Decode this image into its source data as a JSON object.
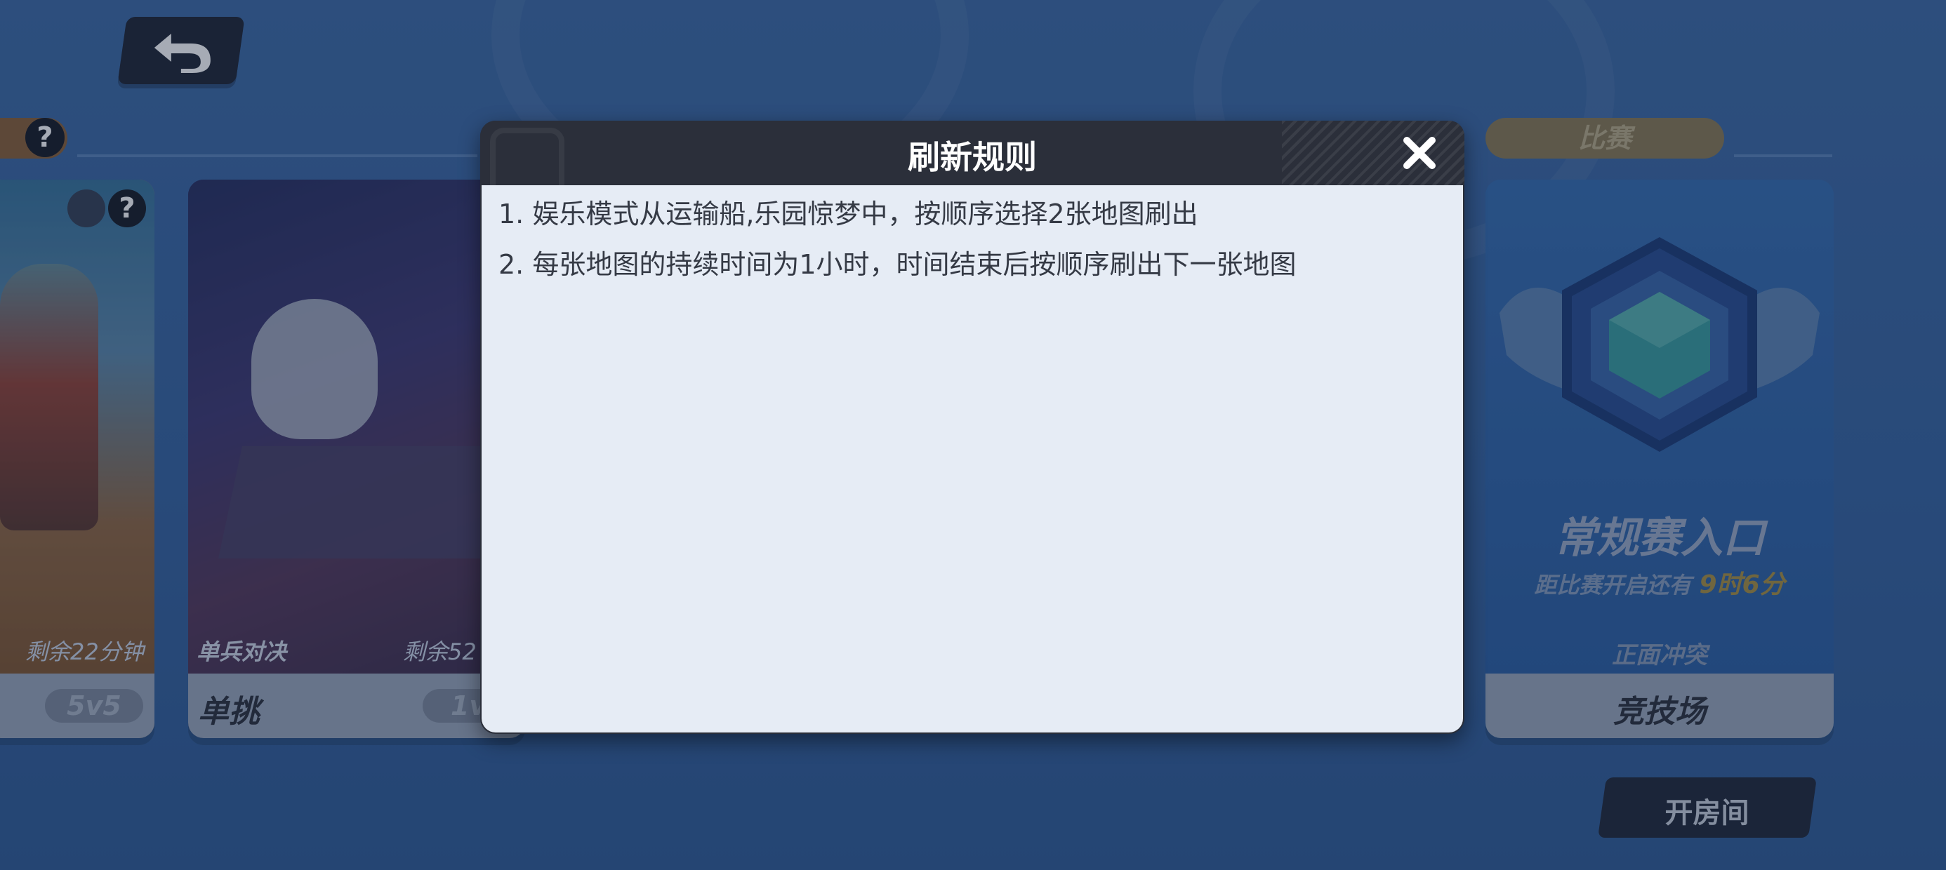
{
  "modal": {
    "title": "刷新规则",
    "rules": [
      "1. 娱乐模式从运输船,乐园惊梦中，按顺序选择2张地图刷出",
      "2. 每张地图的持续时间为1小时，时间结束后按顺序刷出下一张地图"
    ]
  },
  "cards": {
    "left": {
      "remaining": "剩余22分钟",
      "mode_pill": "5v5"
    },
    "solo": {
      "subtitle": "单兵对决",
      "remaining": "剩余52",
      "title": "单挑",
      "mode_pill": "1v"
    },
    "arena": {
      "tag": "比赛",
      "title": "常规赛入口",
      "countdown_prefix": "距比赛开启还有",
      "countdown_value": "9时6分",
      "mode": "正面冲突",
      "footer": "竞技场"
    }
  },
  "buttons": {
    "open_room": "开房间"
  },
  "colors": {
    "accent_gold": "#e6b21b",
    "modal_header": "#2b2f3a",
    "modal_body": "#e6ecf5"
  }
}
